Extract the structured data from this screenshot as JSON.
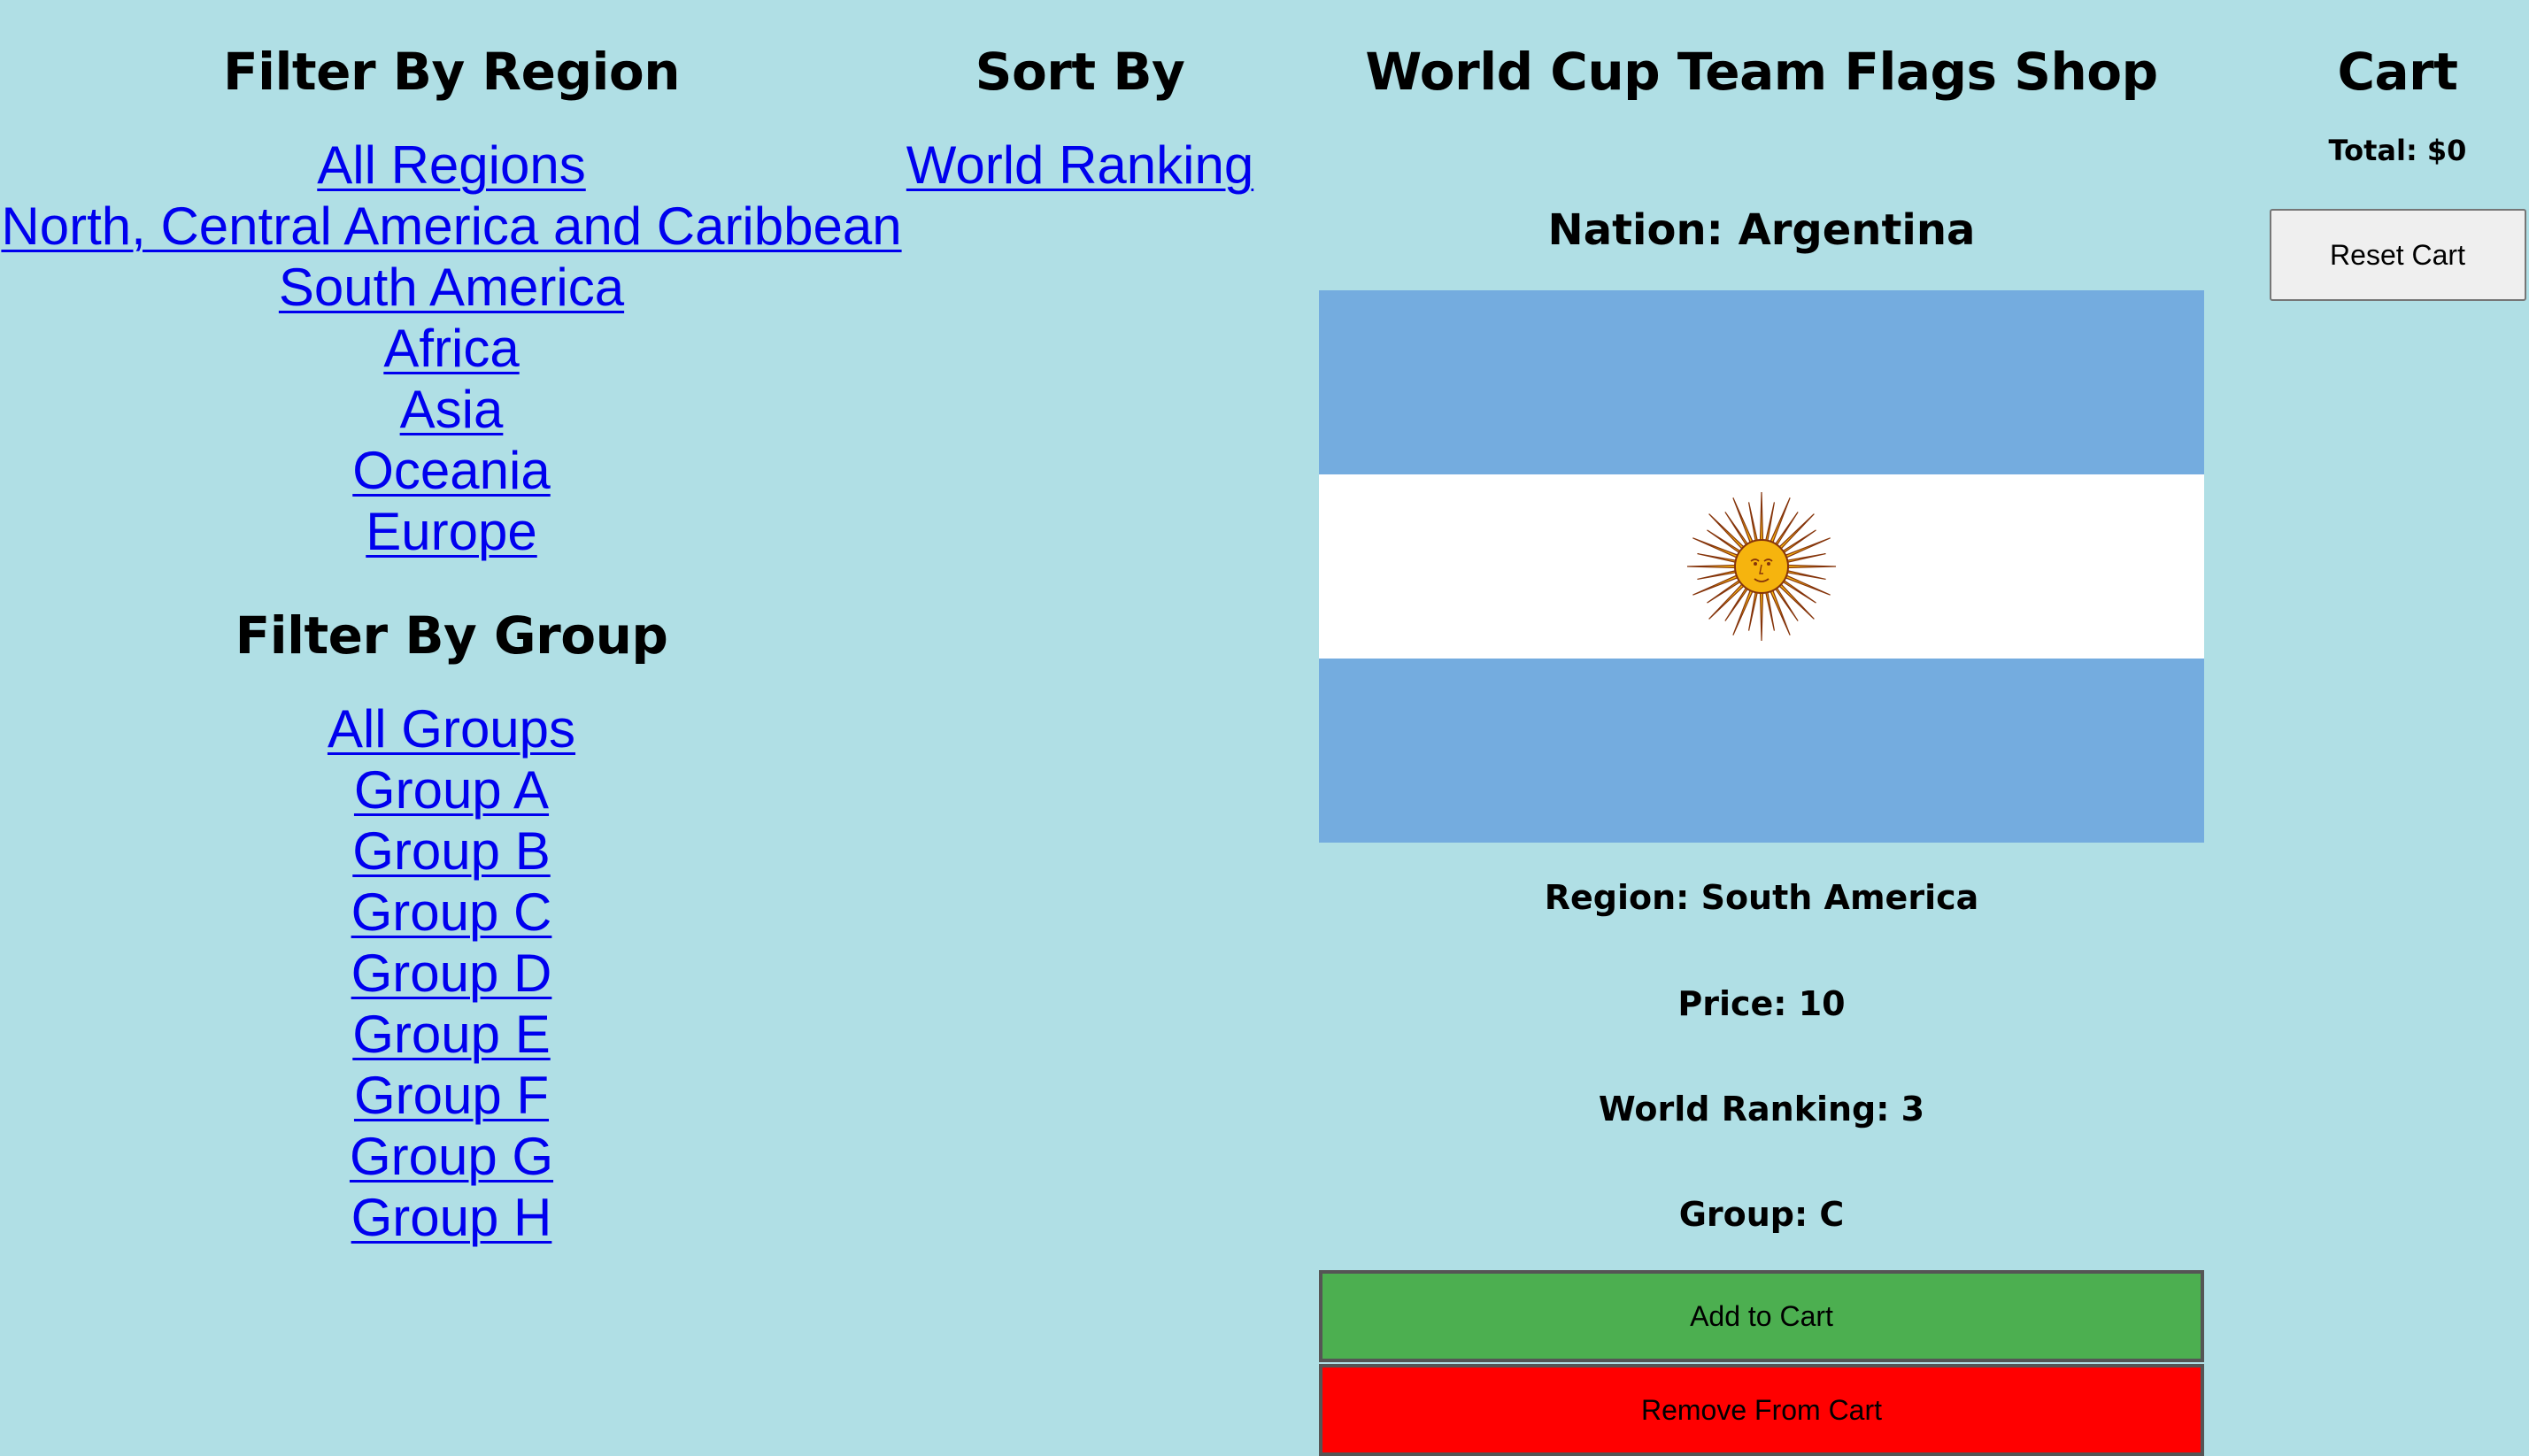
{
  "filter_region": {
    "heading": "Filter By Region",
    "links": [
      "All Regions",
      "North, Central America and Caribbean",
      "South America",
      "Africa",
      "Asia",
      "Oceania",
      "Europe"
    ]
  },
  "filter_group": {
    "heading": "Filter By Group",
    "links": [
      "All Groups",
      "Group A",
      "Group B",
      "Group C",
      "Group D",
      "Group E",
      "Group F",
      "Group G",
      "Group H"
    ]
  },
  "sort": {
    "heading": "Sort By",
    "links": [
      "World Ranking"
    ]
  },
  "shop": {
    "title": "World Cup Team Flags Shop",
    "item": {
      "nation": "Nation: Argentina",
      "flag_icon": "argentina-flag-icon",
      "flag_colors": {
        "blue": "#74acdf",
        "white": "#ffffff",
        "sun": "#f6b40e",
        "sun_outline": "#85340a"
      },
      "region": "Region: South America",
      "price": "Price: 10",
      "ranking": "World Ranking: 3",
      "group": "Group: C",
      "add_label": "Add to Cart",
      "remove_label": "Remove From Cart"
    }
  },
  "cart": {
    "heading": "Cart",
    "total": "Total: $0",
    "reset_label": "Reset Cart"
  },
  "colors": {
    "background": "#b0dfe5",
    "link": "#0000ee",
    "add_button": "#4caf50",
    "remove_button": "#ff0000"
  }
}
